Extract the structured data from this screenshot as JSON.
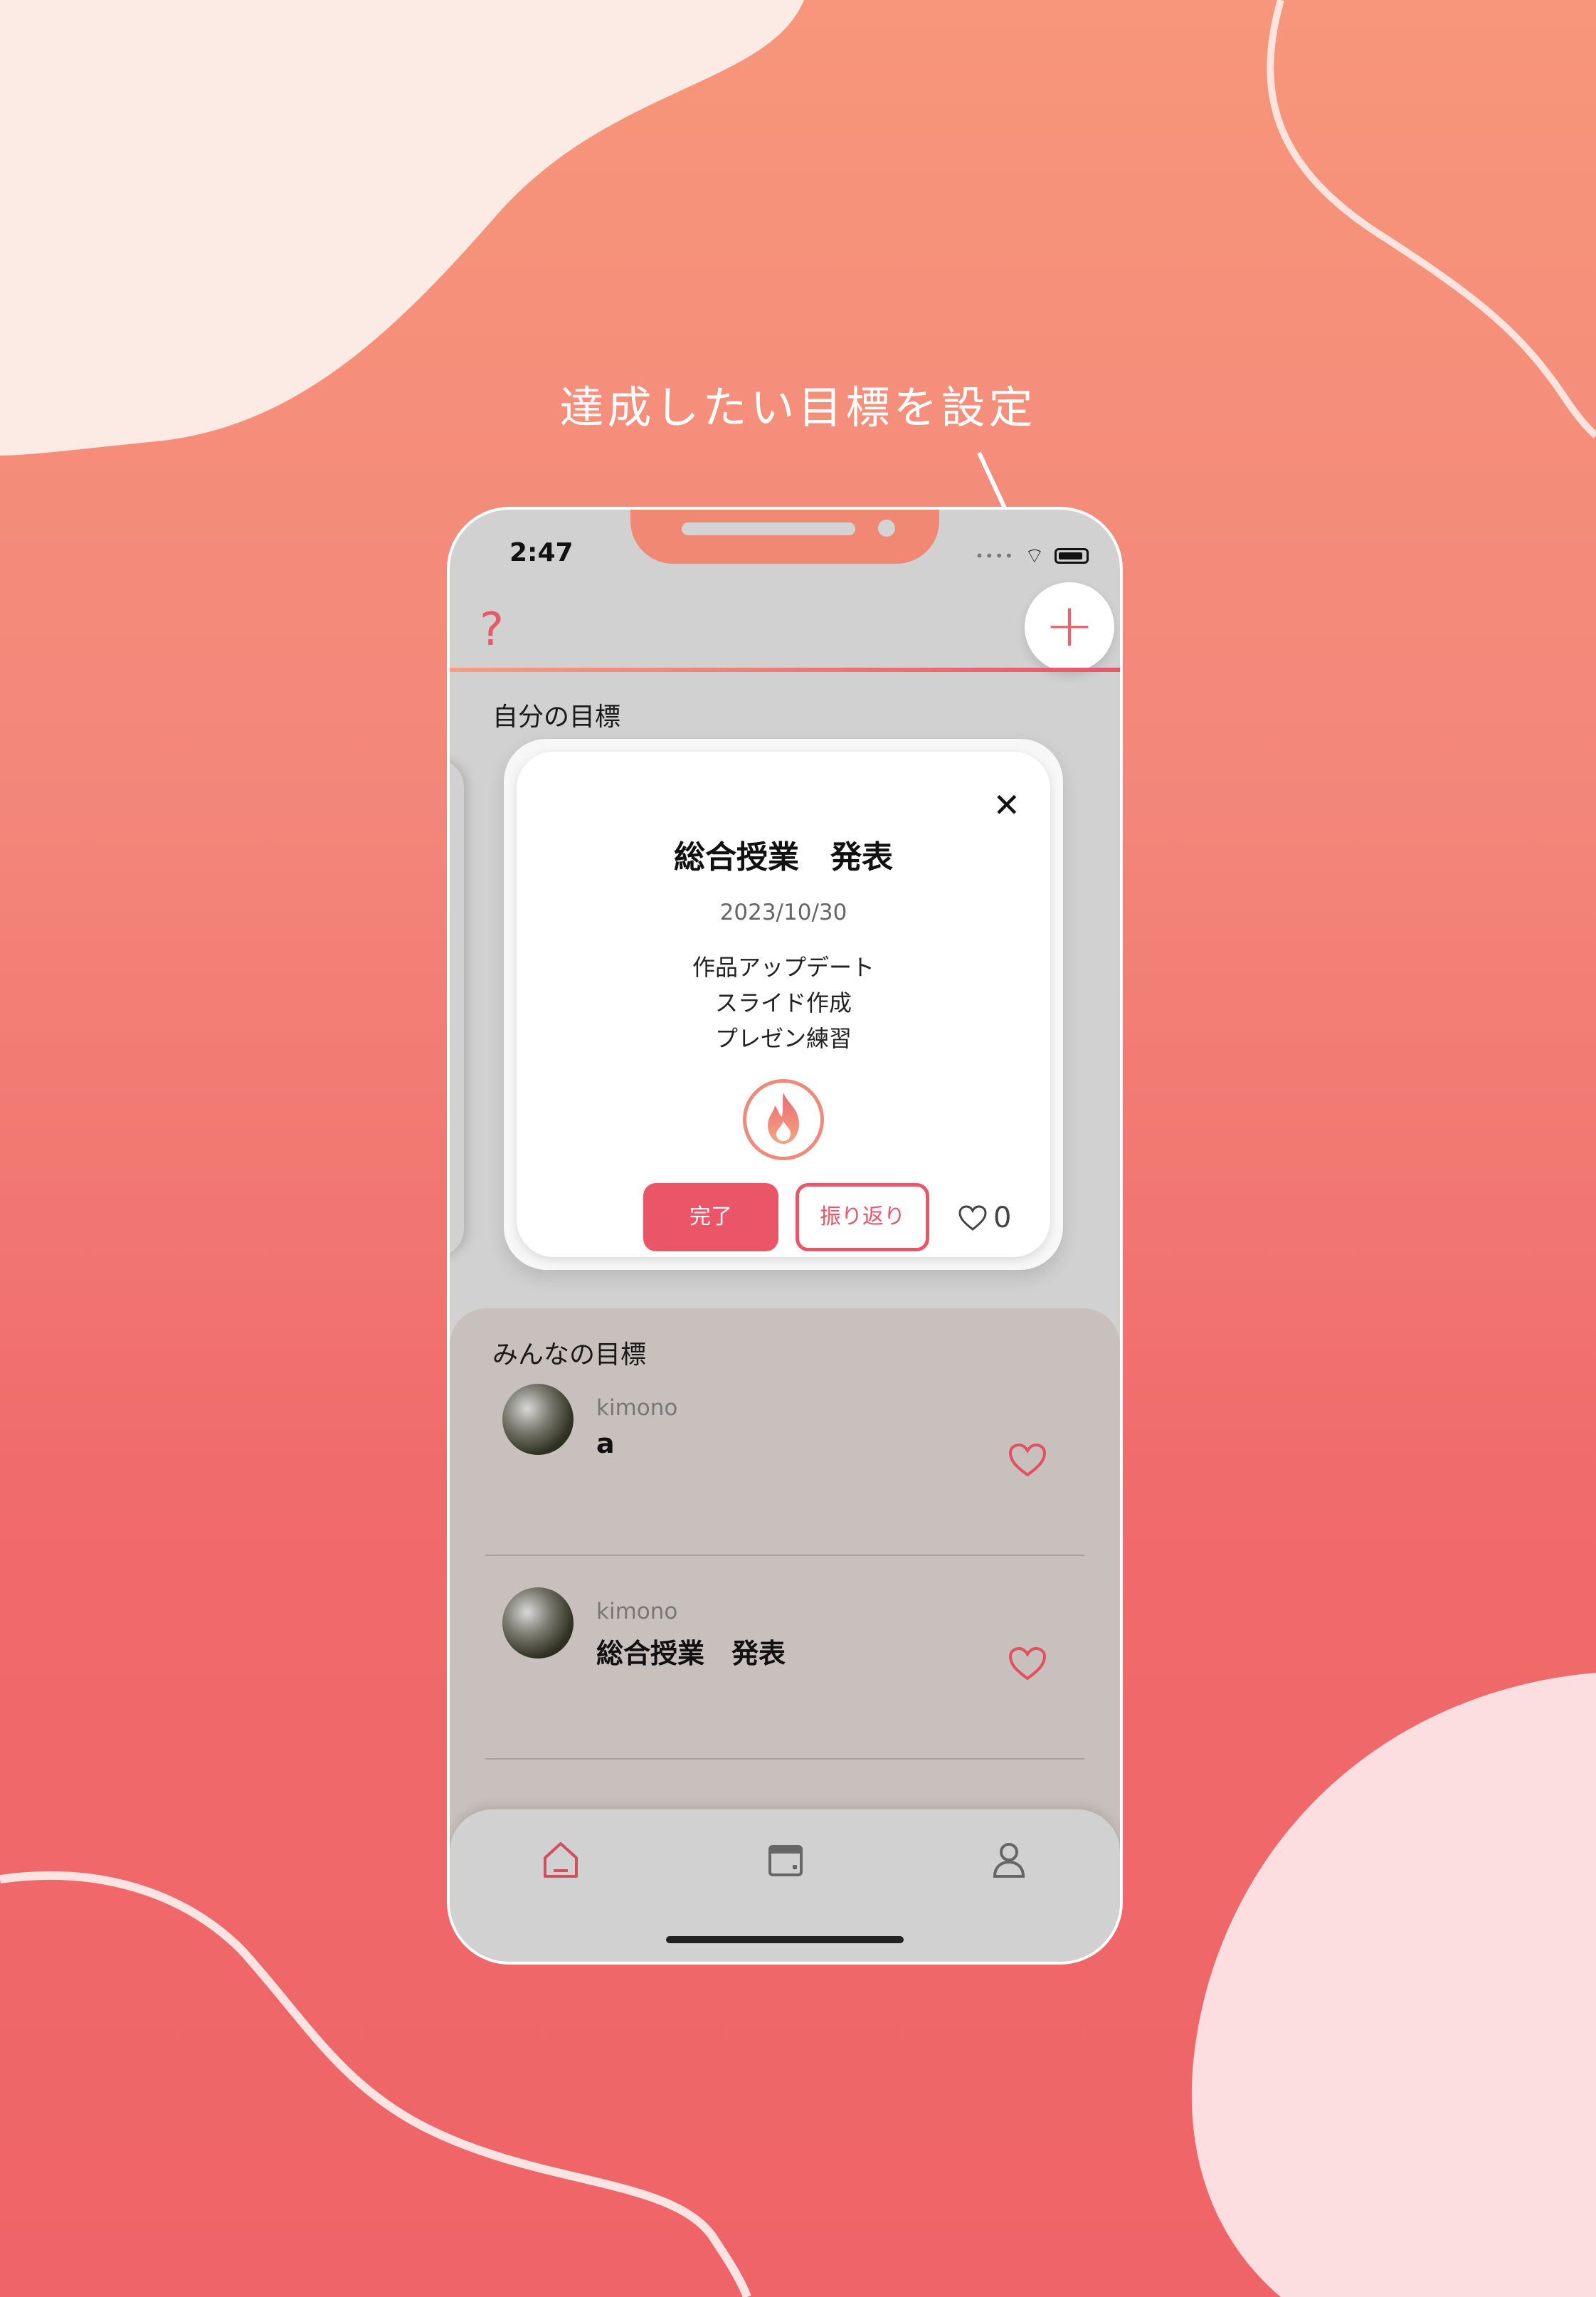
{
  "caption": "達成したい目標を設定",
  "status_bar": {
    "time": "2:47"
  },
  "header": {
    "help_label": "?",
    "add_label": "+"
  },
  "my_goals": {
    "title": "自分の目標",
    "card": {
      "close_label": "✕",
      "title": "総合授業　発表",
      "date": "2023/10/30",
      "tasks": [
        "作品アップデート",
        "スライド作成",
        "プレゼン練習"
      ],
      "icon": "fire-icon",
      "done_label": "完了",
      "review_label": "振り返り",
      "like_count": "0"
    }
  },
  "everyone_goals": {
    "title": "みんなの目標",
    "items": [
      {
        "user": "kimono",
        "text": "a"
      },
      {
        "user": "kimono",
        "text": "総合授業　発表"
      }
    ]
  },
  "tabbar": {
    "tabs": [
      "home-icon",
      "calendar-icon",
      "profile-icon"
    ],
    "active": "home-icon"
  },
  "colors": {
    "accent": "#ea5667",
    "background_top": "#f7967a",
    "background_bottom": "#ef6468"
  }
}
